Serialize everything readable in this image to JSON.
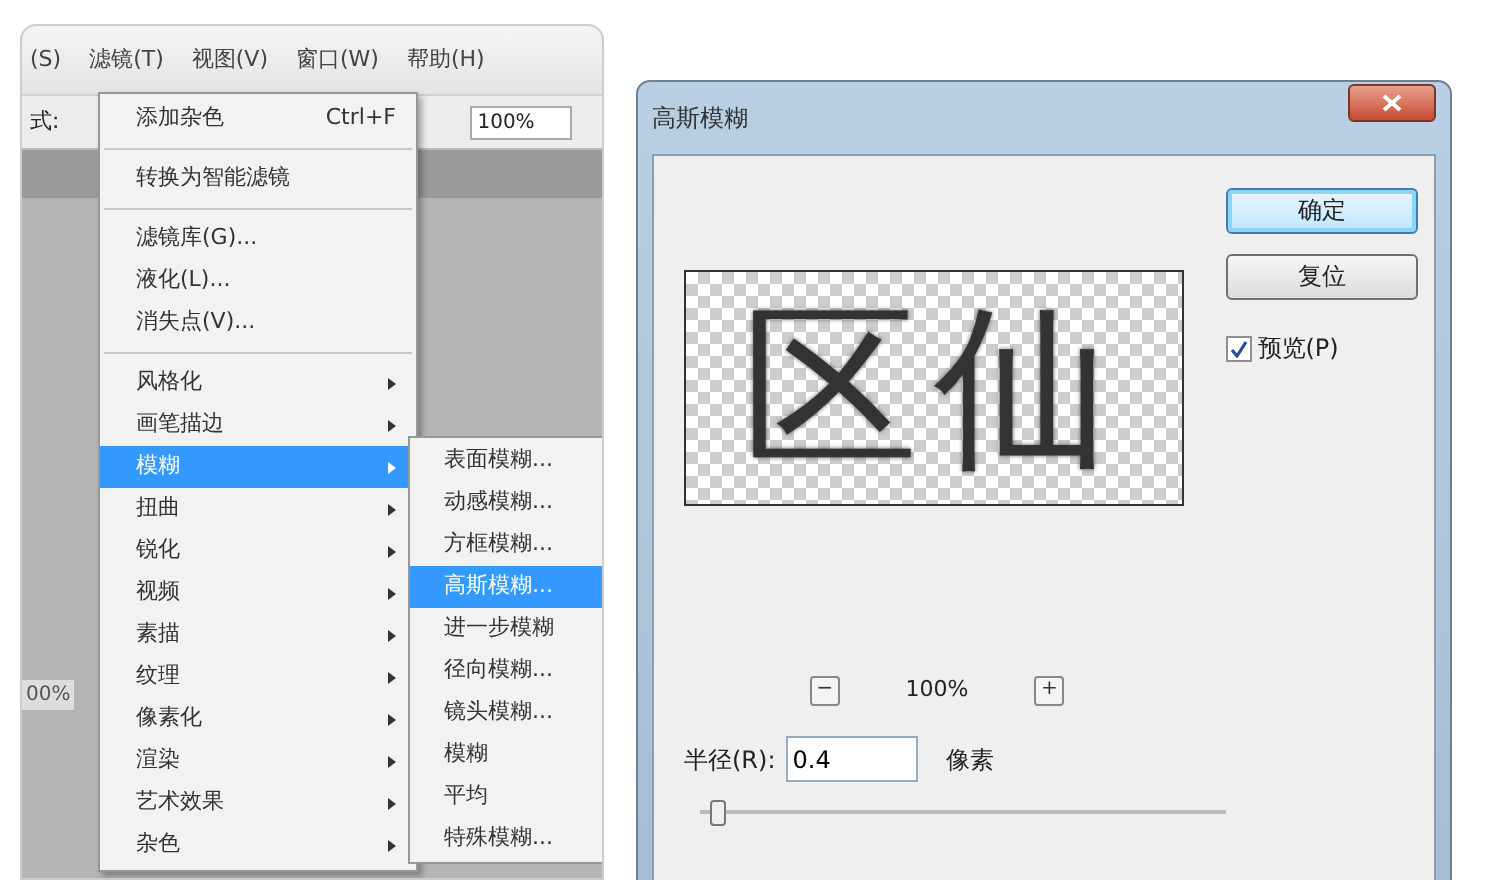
{
  "app": {
    "menubar": [
      "(S)",
      "滤镜(T)",
      "视图(V)",
      "窗口(W)",
      "帮助(H)"
    ],
    "options_label": "式:",
    "zoom_field": "100%",
    "status_zoom": "00%"
  },
  "filter_menu": {
    "items": [
      {
        "kind": "item",
        "label": "添加杂色",
        "shortcut": "Ctrl+F",
        "selected": false
      },
      {
        "kind": "separator"
      },
      {
        "kind": "item",
        "label": "转换为智能滤镜",
        "selected": false
      },
      {
        "kind": "separator"
      },
      {
        "kind": "item",
        "label": "滤镜库(G)...",
        "selected": false
      },
      {
        "kind": "item",
        "label": "液化(L)...",
        "selected": false
      },
      {
        "kind": "item",
        "label": "消失点(V)...",
        "selected": false
      },
      {
        "kind": "separator"
      },
      {
        "kind": "submenu",
        "label": "风格化",
        "selected": false
      },
      {
        "kind": "submenu",
        "label": "画笔描边",
        "selected": false
      },
      {
        "kind": "submenu",
        "label": "模糊",
        "selected": true
      },
      {
        "kind": "submenu",
        "label": "扭曲",
        "selected": false
      },
      {
        "kind": "submenu",
        "label": "锐化",
        "selected": false
      },
      {
        "kind": "submenu",
        "label": "视频",
        "selected": false
      },
      {
        "kind": "submenu",
        "label": "素描",
        "selected": false
      },
      {
        "kind": "submenu",
        "label": "纹理",
        "selected": false
      },
      {
        "kind": "submenu",
        "label": "像素化",
        "selected": false
      },
      {
        "kind": "submenu",
        "label": "渲染",
        "selected": false
      },
      {
        "kind": "submenu",
        "label": "艺术效果",
        "selected": false
      },
      {
        "kind": "submenu",
        "label": "杂色",
        "selected": false
      }
    ]
  },
  "blur_submenu": {
    "items": [
      {
        "label": "表面模糊...",
        "selected": false
      },
      {
        "label": "动感模糊...",
        "selected": false
      },
      {
        "label": "方框模糊...",
        "selected": false
      },
      {
        "label": "高斯模糊...",
        "selected": true
      },
      {
        "label": "进一步模糊",
        "selected": false
      },
      {
        "label": "径向模糊...",
        "selected": false
      },
      {
        "label": "镜头模糊...",
        "selected": false
      },
      {
        "label": "模糊",
        "selected": false
      },
      {
        "label": "平均",
        "selected": false
      },
      {
        "label": "特殊模糊...",
        "selected": false
      }
    ]
  },
  "dialog": {
    "title": "高斯模糊",
    "buttons": [
      {
        "label": "确定",
        "default": true
      },
      {
        "label": "复位",
        "default": false
      }
    ],
    "preview_checkbox": {
      "label": "预览(P)",
      "checked": true
    },
    "preview_text": "区仙",
    "zoom": "100%",
    "zoom_out": "−",
    "zoom_in": "+",
    "radius": {
      "label": "半径(R):",
      "value": "0.4",
      "unit": "像素",
      "level": 0.02
    }
  }
}
